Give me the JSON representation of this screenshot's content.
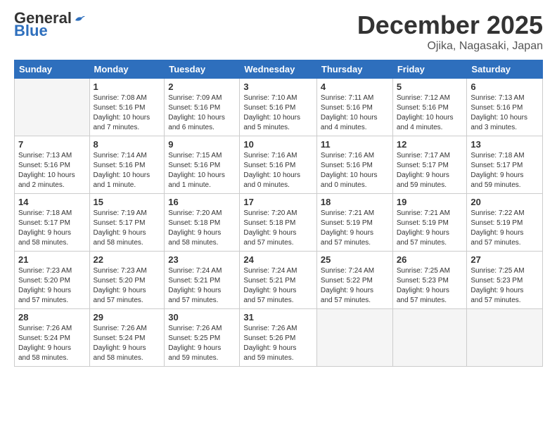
{
  "logo": {
    "line1": "General",
    "line2": "Blue"
  },
  "title": "December 2025",
  "location": "Ojika, Nagasaki, Japan",
  "headers": [
    "Sunday",
    "Monday",
    "Tuesday",
    "Wednesday",
    "Thursday",
    "Friday",
    "Saturday"
  ],
  "weeks": [
    [
      {
        "day": "",
        "detail": ""
      },
      {
        "day": "1",
        "detail": "Sunrise: 7:08 AM\nSunset: 5:16 PM\nDaylight: 10 hours\nand 7 minutes."
      },
      {
        "day": "2",
        "detail": "Sunrise: 7:09 AM\nSunset: 5:16 PM\nDaylight: 10 hours\nand 6 minutes."
      },
      {
        "day": "3",
        "detail": "Sunrise: 7:10 AM\nSunset: 5:16 PM\nDaylight: 10 hours\nand 5 minutes."
      },
      {
        "day": "4",
        "detail": "Sunrise: 7:11 AM\nSunset: 5:16 PM\nDaylight: 10 hours\nand 4 minutes."
      },
      {
        "day": "5",
        "detail": "Sunrise: 7:12 AM\nSunset: 5:16 PM\nDaylight: 10 hours\nand 4 minutes."
      },
      {
        "day": "6",
        "detail": "Sunrise: 7:13 AM\nSunset: 5:16 PM\nDaylight: 10 hours\nand 3 minutes."
      }
    ],
    [
      {
        "day": "7",
        "detail": "Sunrise: 7:13 AM\nSunset: 5:16 PM\nDaylight: 10 hours\nand 2 minutes."
      },
      {
        "day": "8",
        "detail": "Sunrise: 7:14 AM\nSunset: 5:16 PM\nDaylight: 10 hours\nand 1 minute."
      },
      {
        "day": "9",
        "detail": "Sunrise: 7:15 AM\nSunset: 5:16 PM\nDaylight: 10 hours\nand 1 minute."
      },
      {
        "day": "10",
        "detail": "Sunrise: 7:16 AM\nSunset: 5:16 PM\nDaylight: 10 hours\nand 0 minutes."
      },
      {
        "day": "11",
        "detail": "Sunrise: 7:16 AM\nSunset: 5:16 PM\nDaylight: 10 hours\nand 0 minutes."
      },
      {
        "day": "12",
        "detail": "Sunrise: 7:17 AM\nSunset: 5:17 PM\nDaylight: 9 hours\nand 59 minutes."
      },
      {
        "day": "13",
        "detail": "Sunrise: 7:18 AM\nSunset: 5:17 PM\nDaylight: 9 hours\nand 59 minutes."
      }
    ],
    [
      {
        "day": "14",
        "detail": "Sunrise: 7:18 AM\nSunset: 5:17 PM\nDaylight: 9 hours\nand 58 minutes."
      },
      {
        "day": "15",
        "detail": "Sunrise: 7:19 AM\nSunset: 5:17 PM\nDaylight: 9 hours\nand 58 minutes."
      },
      {
        "day": "16",
        "detail": "Sunrise: 7:20 AM\nSunset: 5:18 PM\nDaylight: 9 hours\nand 58 minutes."
      },
      {
        "day": "17",
        "detail": "Sunrise: 7:20 AM\nSunset: 5:18 PM\nDaylight: 9 hours\nand 57 minutes."
      },
      {
        "day": "18",
        "detail": "Sunrise: 7:21 AM\nSunset: 5:19 PM\nDaylight: 9 hours\nand 57 minutes."
      },
      {
        "day": "19",
        "detail": "Sunrise: 7:21 AM\nSunset: 5:19 PM\nDaylight: 9 hours\nand 57 minutes."
      },
      {
        "day": "20",
        "detail": "Sunrise: 7:22 AM\nSunset: 5:19 PM\nDaylight: 9 hours\nand 57 minutes."
      }
    ],
    [
      {
        "day": "21",
        "detail": "Sunrise: 7:23 AM\nSunset: 5:20 PM\nDaylight: 9 hours\nand 57 minutes."
      },
      {
        "day": "22",
        "detail": "Sunrise: 7:23 AM\nSunset: 5:20 PM\nDaylight: 9 hours\nand 57 minutes."
      },
      {
        "day": "23",
        "detail": "Sunrise: 7:24 AM\nSunset: 5:21 PM\nDaylight: 9 hours\nand 57 minutes."
      },
      {
        "day": "24",
        "detail": "Sunrise: 7:24 AM\nSunset: 5:21 PM\nDaylight: 9 hours\nand 57 minutes."
      },
      {
        "day": "25",
        "detail": "Sunrise: 7:24 AM\nSunset: 5:22 PM\nDaylight: 9 hours\nand 57 minutes."
      },
      {
        "day": "26",
        "detail": "Sunrise: 7:25 AM\nSunset: 5:23 PM\nDaylight: 9 hours\nand 57 minutes."
      },
      {
        "day": "27",
        "detail": "Sunrise: 7:25 AM\nSunset: 5:23 PM\nDaylight: 9 hours\nand 57 minutes."
      }
    ],
    [
      {
        "day": "28",
        "detail": "Sunrise: 7:26 AM\nSunset: 5:24 PM\nDaylight: 9 hours\nand 58 minutes."
      },
      {
        "day": "29",
        "detail": "Sunrise: 7:26 AM\nSunset: 5:24 PM\nDaylight: 9 hours\nand 58 minutes."
      },
      {
        "day": "30",
        "detail": "Sunrise: 7:26 AM\nSunset: 5:25 PM\nDaylight: 9 hours\nand 59 minutes."
      },
      {
        "day": "31",
        "detail": "Sunrise: 7:26 AM\nSunset: 5:26 PM\nDaylight: 9 hours\nand 59 minutes."
      },
      {
        "day": "",
        "detail": ""
      },
      {
        "day": "",
        "detail": ""
      },
      {
        "day": "",
        "detail": ""
      }
    ]
  ]
}
